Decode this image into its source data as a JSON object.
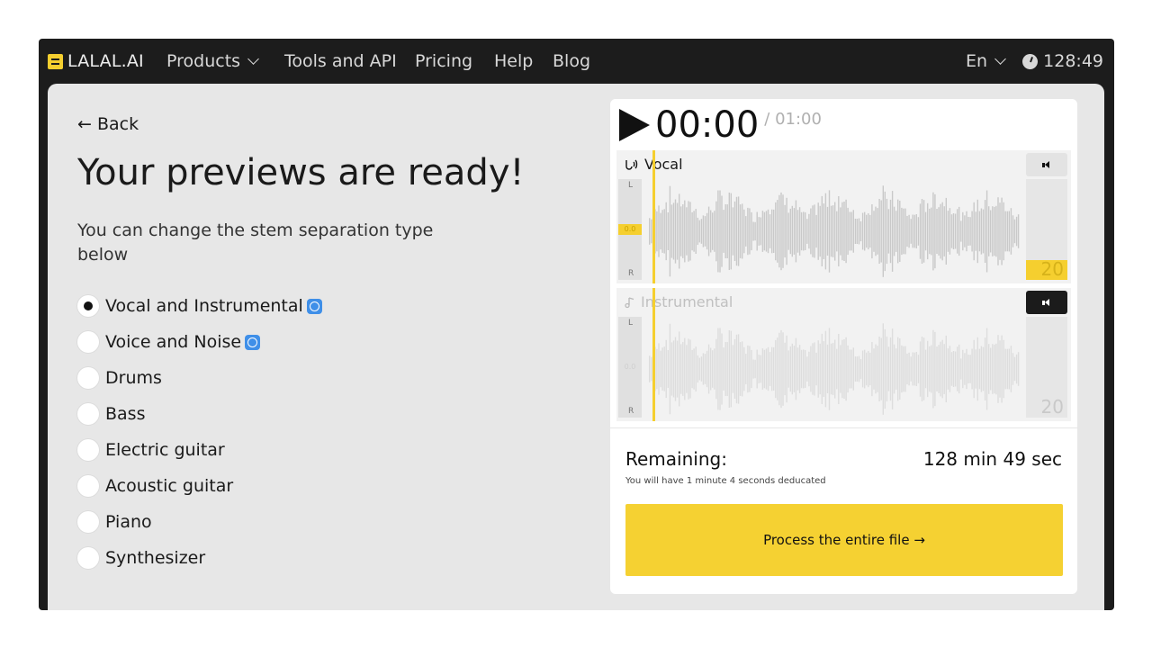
{
  "nav": {
    "logo": "LALAL.AI",
    "items": [
      "Products",
      "Tools and API",
      "Pricing",
      "Help",
      "Blog"
    ],
    "language": "En",
    "timer": "128:49"
  },
  "main": {
    "back_label": "← Back",
    "heading": "Your previews are ready!",
    "subtitle": "You can change the stem separation type below",
    "options": [
      {
        "label": "Vocal and Instrumental",
        "selected": true,
        "badge": true
      },
      {
        "label": "Voice and Noise",
        "selected": false,
        "badge": true
      },
      {
        "label": "Drums",
        "selected": false,
        "badge": false
      },
      {
        "label": "Bass",
        "selected": false,
        "badge": false
      },
      {
        "label": "Electric guitar",
        "selected": false,
        "badge": false
      },
      {
        "label": "Acoustic guitar",
        "selected": false,
        "badge": false
      },
      {
        "label": "Piano",
        "selected": false,
        "badge": false
      },
      {
        "label": "Synthesizer",
        "selected": false,
        "badge": false
      }
    ]
  },
  "player": {
    "current_time": "00:00",
    "duration": "/ 01:00",
    "tracks": [
      {
        "name": "Vocal",
        "left": "L",
        "right": "R",
        "level": "0.0",
        "meter_value": "20",
        "muted": false
      },
      {
        "name": "Instrumental",
        "left": "L",
        "right": "R",
        "level": "0.0",
        "meter_value": "20",
        "muted": true
      }
    ],
    "remaining_label": "Remaining:",
    "remaining_value": "128 min 49 sec",
    "deduction_note": "You will have 1 minute 4 seconds deducated",
    "process_button": "Process the entire file →"
  },
  "colors": {
    "accent": "#f5cf2f",
    "nav_bg": "#1c1c1c",
    "content_bg": "#e7e7e7",
    "badge": "#3f8fe8"
  }
}
